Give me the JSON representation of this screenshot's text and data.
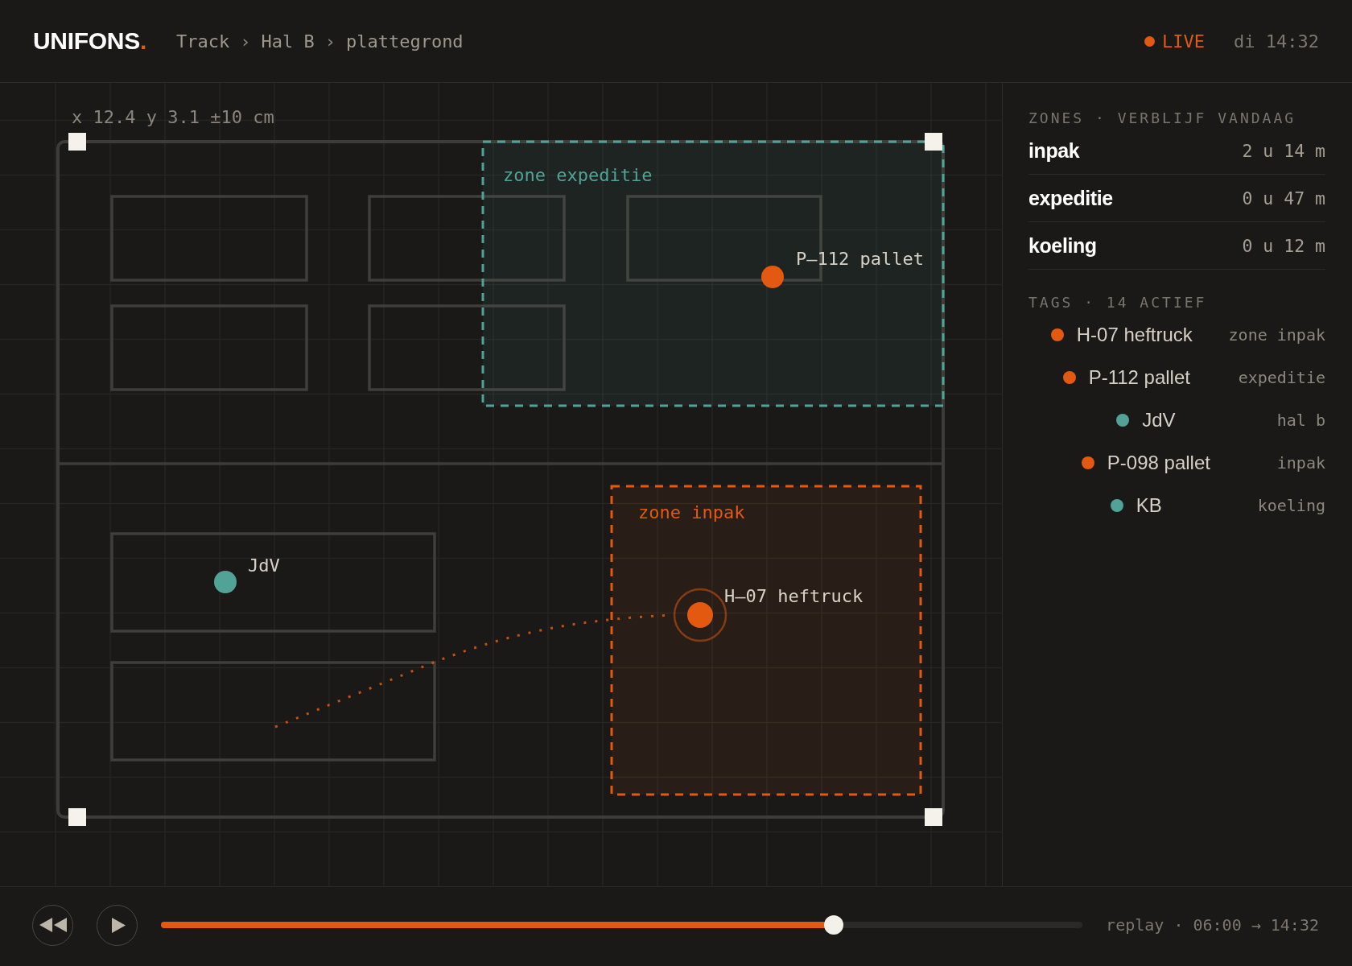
{
  "header": {
    "logo": {
      "text": "UNIFONS",
      "dot": "."
    },
    "breadcrumb": [
      {
        "kind": "crumb",
        "label": "Track"
      },
      {
        "kind": "separator",
        "label": "›"
      },
      {
        "kind": "crumb",
        "label": "Hal B"
      },
      {
        "kind": "separator",
        "label": "›"
      },
      {
        "kind": "crumb",
        "label": "plattegrond"
      }
    ],
    "live": {
      "label": "LIVE",
      "on": true
    },
    "clock": "di 14:32"
  },
  "map": {
    "coordinates": "x 12.4 y 3.1 ±10 cm",
    "zones": [
      {
        "label": "zone expeditie",
        "color": "#52a397"
      },
      {
        "label": "zone inpak",
        "color": "#e2590f"
      }
    ],
    "tags": [
      {
        "label": "P–112 pallet",
        "color": "#e2590f",
        "selected": false
      },
      {
        "label": "JdV",
        "color": "#52a397",
        "selected": false
      },
      {
        "label": "H–07 heftruck",
        "color": "#e2590f",
        "selected": true
      }
    ]
  },
  "sidebar": {
    "zones": {
      "title": "ZONES · VERBLIJF VANDAAG",
      "rows": [
        {
          "name": "inpak",
          "duration": "2 u 14 m"
        },
        {
          "name": "expeditie",
          "duration": "0 u 47 m"
        },
        {
          "name": "koeling",
          "duration": "0 u 12 m"
        }
      ]
    },
    "tags": {
      "title": "TAGS · 14 ACTIEF",
      "rows": [
        {
          "name": "H-07 heftruck",
          "location": "zone inpak",
          "color": "#e2590f"
        },
        {
          "name": "P-112 pallet",
          "location": "expeditie",
          "color": "#e2590f"
        },
        {
          "name": "JdV",
          "location": "hal b",
          "color": "#52a397"
        },
        {
          "name": "P-098 pallet",
          "location": "inpak",
          "color": "#e2590f"
        },
        {
          "name": "KB",
          "location": "koeling",
          "color": "#52a397"
        }
      ]
    }
  },
  "player": {
    "playing": false,
    "level": 0.73,
    "label": "replay · 06:00 → 14:32"
  }
}
